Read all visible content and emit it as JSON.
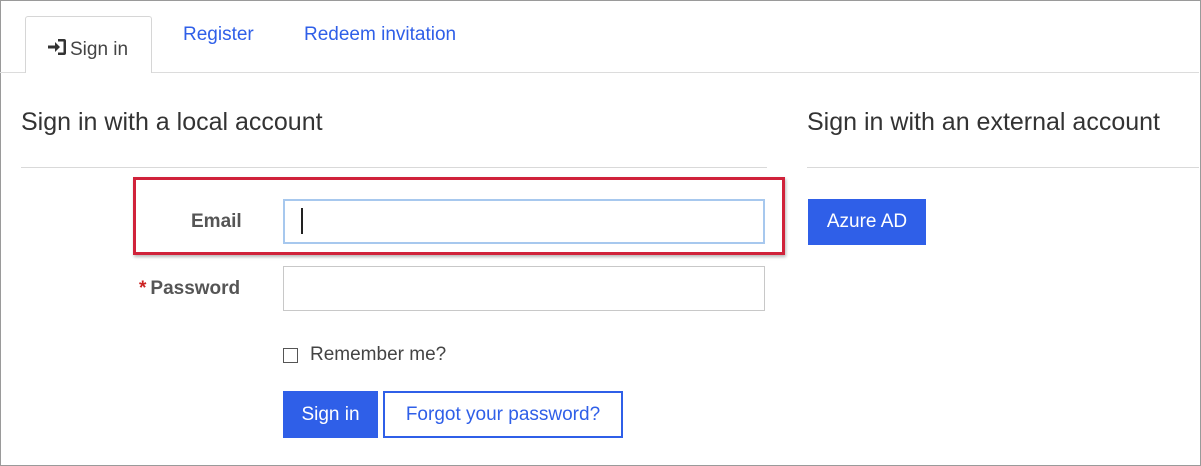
{
  "tabs": [
    {
      "label": "Sign in",
      "icon": "sign-in-icon",
      "active": true
    },
    {
      "label": "Register",
      "active": false
    },
    {
      "label": "Redeem invitation",
      "active": false
    }
  ],
  "local": {
    "heading": "Sign in with a local account",
    "email_label": "Email",
    "email_value": "",
    "password_required_marker": "*",
    "password_label": "Password",
    "password_value": "",
    "remember_label": "Remember me?",
    "remember_checked": false,
    "sign_in_button": "Sign in",
    "forgot_button": "Forgot your password?"
  },
  "external": {
    "heading": "Sign in with an external account",
    "providers": [
      {
        "label": "Azure AD"
      }
    ]
  },
  "colors": {
    "accent": "#2f5fe8",
    "highlight": "#d0223a",
    "required": "#cc2222"
  }
}
